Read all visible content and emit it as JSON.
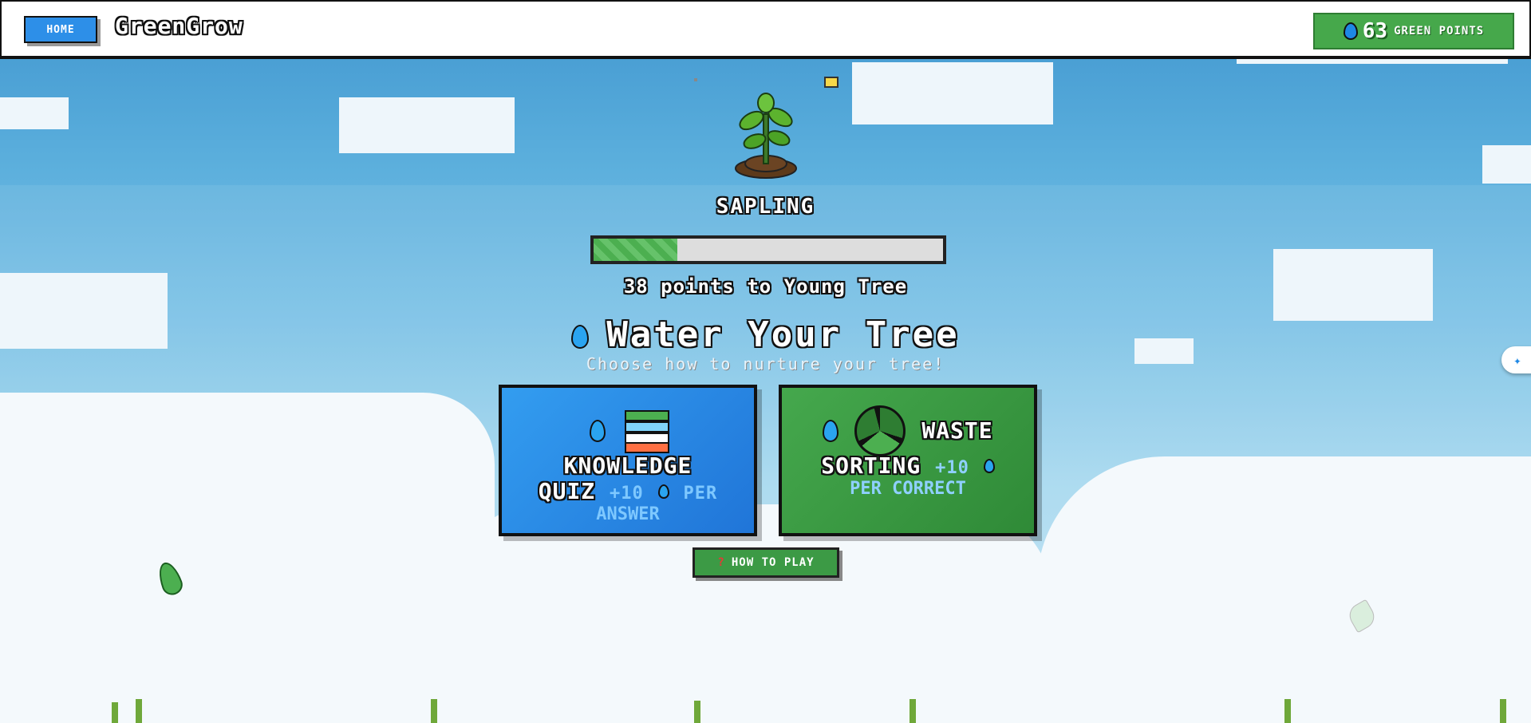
{
  "header": {
    "home_label": "HOME",
    "brand": "GreenGrow",
    "points_value": "63",
    "points_label": "GREEN POINTS"
  },
  "tree": {
    "stage": "SAPLING",
    "progress_fraction": 0.24,
    "remaining_text": "38 points to Young Tree"
  },
  "main": {
    "title": "Water Your Tree",
    "subtitle": "Choose how to nurture your tree!"
  },
  "cards": {
    "quiz": {
      "line1": "KNOWLEDGE",
      "line2": "QUIZ",
      "bonus": "+10",
      "bonus_suffix": "PER",
      "bonus_line2": "ANSWER"
    },
    "waste": {
      "line1": "WASTE",
      "line2": "SORTING",
      "bonus": "+10",
      "bonus_line2": "PER CORRECT"
    }
  },
  "howto_label": "HOW TO PLAY",
  "icons": {
    "points": "water-drop-icon",
    "quiz": "books-icon",
    "waste": "recycle-icon",
    "howto": "question-mark-icon",
    "side": "sparkle-drop-icon"
  }
}
